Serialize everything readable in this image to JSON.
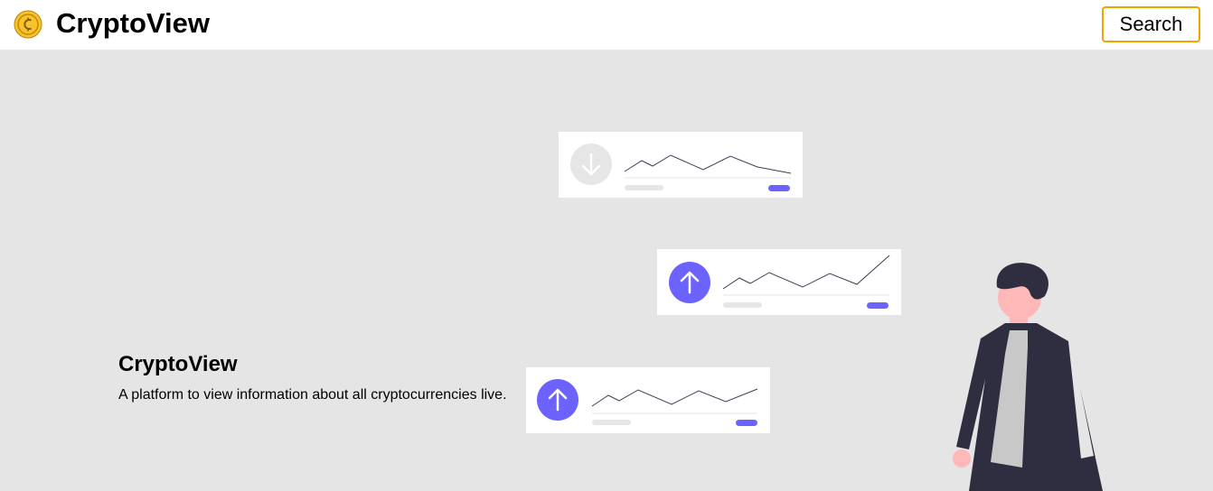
{
  "navbar": {
    "brand": "CryptoView",
    "logo_icon": "coin-icon",
    "search_label": "Search"
  },
  "hero": {
    "title": "CryptoView",
    "description": "A platform to view information about all cryptocurrencies live."
  },
  "illustration": {
    "cards": [
      {
        "trend": "down",
        "icon": "arrow-down-icon"
      },
      {
        "trend": "up",
        "icon": "arrow-up-icon"
      },
      {
        "trend": "up",
        "icon": "arrow-up-icon"
      }
    ]
  },
  "colors": {
    "accent": "#6c63ff",
    "search_border": "#f0a500",
    "background": "#e5e5e5",
    "coin": "#f7c22b"
  }
}
